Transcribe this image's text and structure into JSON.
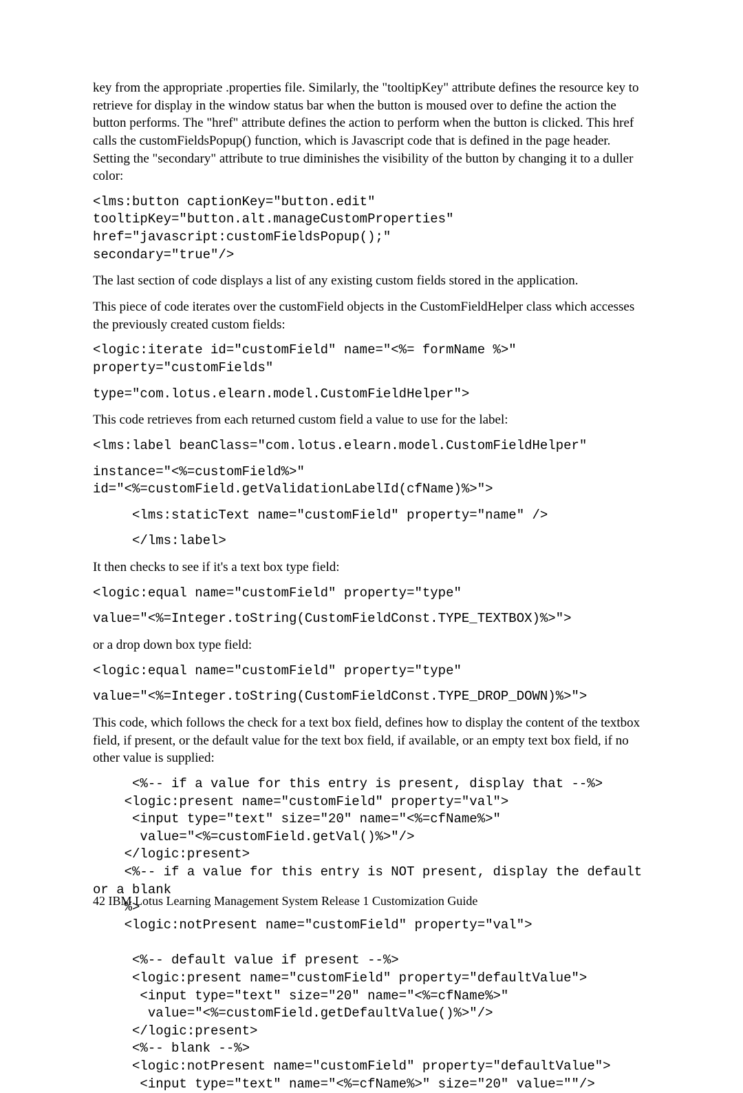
{
  "p1": "key from the appropriate .properties file. Similarly, the \"tooltipKey\" attribute defines the resource key to retrieve for display in the window status bar when the button is moused over to define the action the button performs. The \"href\" attribute defines the action to perform when the button is clicked. This href calls the customFieldsPopup() function, which is Javascript code that is defined in the page header. Setting the \"secondary\" attribute to true diminishes the visibility of the button by changing it to a duller color:",
  "c1": "<lms:button captionKey=\"button.edit\"\ntooltipKey=\"button.alt.manageCustomProperties\"\nhref=\"javascript:customFieldsPopup();\"\nsecondary=\"true\"/>",
  "p2": "The last section of code displays a list of any existing custom fields stored in the application.",
  "p3": "This piece of code iterates over the customField objects in the CustomFieldHelper class which accesses the previously created custom fields:",
  "c2": "<logic:iterate id=\"customField\" name=\"<%= formName %>\"\nproperty=\"customFields\"",
  "c3": "type=\"com.lotus.elearn.model.CustomFieldHelper\">",
  "p4": "This code retrieves from each returned custom field a value to use for the label:",
  "c4": "<lms:label beanClass=\"com.lotus.elearn.model.CustomFieldHelper\"",
  "c5": "instance=\"<%=customField%>\"\nid=\"<%=customField.getValidationLabelId(cfName)%>\">",
  "c6": "     <lms:staticText name=\"customField\" property=\"name\" />",
  "c7": "     </lms:label>",
  "p5": "It then checks to see if it's a text box type field:",
  "c8": "<logic:equal name=\"customField\" property=\"type\"",
  "c9": "value=\"<%=Integer.toString(CustomFieldConst.TYPE_TEXTBOX)%>\">",
  "p6": "or a drop down box type field:",
  "c10": "<logic:equal name=\"customField\" property=\"type\"",
  "c11": "value=\"<%=Integer.toString(CustomFieldConst.TYPE_DROP_DOWN)%>\">",
  "p7": "This code, which follows the check for a text box field, defines how to display the content of the textbox field, if present, or the default value for the text box field, if available, or an empty text box field, if no other value is supplied:",
  "c12": "     <%-- if a value for this entry is present, display that --%>\n    <logic:present name=\"customField\" property=\"val\">\n     <input type=\"text\" size=\"20\" name=\"<%=cfName%>\"\n      value=\"<%=customField.getVal()%>\"/>\n    </logic:present>\n    <%-- if a value for this entry is NOT present, display the default\nor a blank\n    %>\n    <logic:notPresent name=\"customField\" property=\"val\">\n\n     <%-- default value if present --%>\n     <logic:present name=\"customField\" property=\"defaultValue\">\n      <input type=\"text\" size=\"20\" name=\"<%=cfName%>\"\n       value=\"<%=customField.getDefaultValue()%>\"/>\n     </logic:present>\n     <%-- blank --%>\n     <logic:notPresent name=\"customField\" property=\"defaultValue\">\n      <input type=\"text\" name=\"<%=cfName%>\" size=\"20\" value=\"\"/>",
  "footer_page": "42",
  "footer_title": "IBM Lotus Learning Management System Release 1 Customization Guide"
}
